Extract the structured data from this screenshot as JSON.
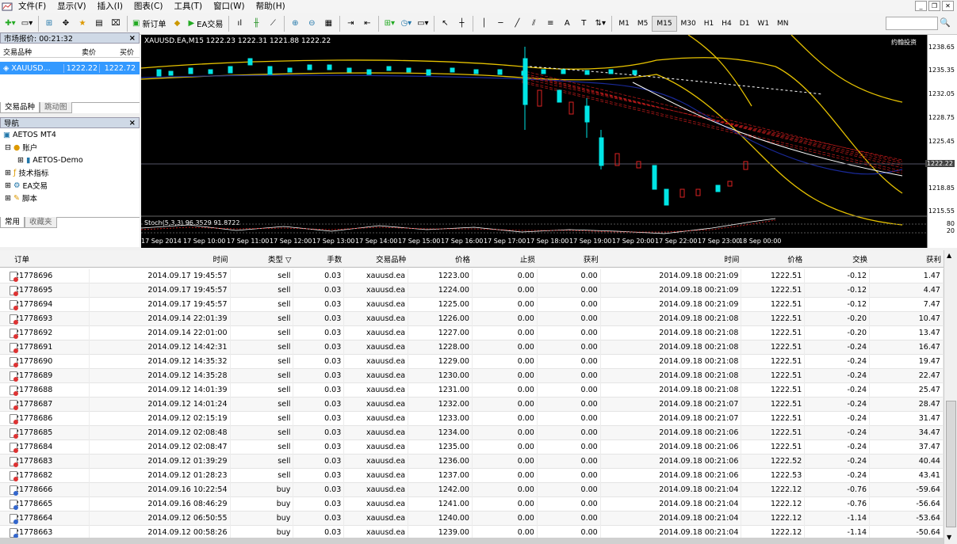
{
  "menu": {
    "items": [
      "文件(F)",
      "显示(V)",
      "插入(I)",
      "图表(C)",
      "工具(T)",
      "窗口(W)",
      "帮助(H)"
    ]
  },
  "toolbar": {
    "new_order": "新订单",
    "ea_trade": "EA交易",
    "timeframes": [
      "M1",
      "M5",
      "M15",
      "M30",
      "H1",
      "H4",
      "D1",
      "W1",
      "MN"
    ],
    "active_tf": "M15"
  },
  "market_watch": {
    "title": "市场报价: 00:21:32",
    "col_symbol": "交易品种",
    "col_bid": "卖价",
    "col_ask": "买价",
    "row": {
      "symbol": "XAUUSD...",
      "bid": "1222.22",
      "ask": "1222.72"
    },
    "tabs": [
      "交易品种",
      "跳动图"
    ]
  },
  "navigator": {
    "title": "导航",
    "items": [
      "AETOS MT4",
      "账户",
      "AETOS-Demo",
      "技术指标",
      "EA交易",
      "脚本"
    ],
    "tabs": [
      "常用",
      "收藏夹"
    ]
  },
  "chart": {
    "header": "XAUUSD.EA,M15  1222.23 1222.31 1221.88 1222.22",
    "corner_label": "约翰投资",
    "stoch_label": "Stoch(5,3,3) 96.3529 91.8722",
    "price_ticks": [
      "1238.65",
      "1235.35",
      "1232.05",
      "1228.75",
      "1225.45",
      "1222.22",
      "1218.85",
      "1215.55"
    ],
    "stoch_ticks": [
      "80",
      "20"
    ],
    "time_ticks": [
      "17 Sep 2014",
      "17 Sep 10:00",
      "17 Sep 11:00",
      "17 Sep 12:00",
      "17 Sep 13:00",
      "17 Sep 14:00",
      "17 Sep 15:00",
      "17 Sep 16:00",
      "17 Sep 17:00",
      "17 Sep 18:00",
      "17 Sep 19:00",
      "17 Sep 20:00",
      "17 Sep 22:00",
      "17 Sep 23:00",
      "18 Sep 00:00"
    ]
  },
  "terminal": {
    "headers": [
      "订单",
      "时间",
      "类型",
      "手数",
      "交易品种",
      "价格",
      "止损",
      "获利",
      "时间",
      "价格",
      "交换",
      "获利"
    ],
    "rows": [
      [
        "21778696",
        "2014.09.17 19:45:57",
        "sell",
        "0.03",
        "xauusd.ea",
        "1223.00",
        "0.00",
        "0.00",
        "2014.09.18 00:21:09",
        "1222.51",
        "-0.12",
        "1.47"
      ],
      [
        "21778695",
        "2014.09.17 19:45:57",
        "sell",
        "0.03",
        "xauusd.ea",
        "1224.00",
        "0.00",
        "0.00",
        "2014.09.18 00:21:09",
        "1222.51",
        "-0.12",
        "4.47"
      ],
      [
        "21778694",
        "2014.09.17 19:45:57",
        "sell",
        "0.03",
        "xauusd.ea",
        "1225.00",
        "0.00",
        "0.00",
        "2014.09.18 00:21:09",
        "1222.51",
        "-0.12",
        "7.47"
      ],
      [
        "21778693",
        "2014.09.14 22:01:39",
        "sell",
        "0.03",
        "xauusd.ea",
        "1226.00",
        "0.00",
        "0.00",
        "2014.09.18 00:21:08",
        "1222.51",
        "-0.20",
        "10.47"
      ],
      [
        "21778692",
        "2014.09.14 22:01:00",
        "sell",
        "0.03",
        "xauusd.ea",
        "1227.00",
        "0.00",
        "0.00",
        "2014.09.18 00:21:08",
        "1222.51",
        "-0.20",
        "13.47"
      ],
      [
        "21778691",
        "2014.09.12 14:42:31",
        "sell",
        "0.03",
        "xauusd.ea",
        "1228.00",
        "0.00",
        "0.00",
        "2014.09.18 00:21:08",
        "1222.51",
        "-0.24",
        "16.47"
      ],
      [
        "21778690",
        "2014.09.12 14:35:32",
        "sell",
        "0.03",
        "xauusd.ea",
        "1229.00",
        "0.00",
        "0.00",
        "2014.09.18 00:21:08",
        "1222.51",
        "-0.24",
        "19.47"
      ],
      [
        "21778689",
        "2014.09.12 14:35:28",
        "sell",
        "0.03",
        "xauusd.ea",
        "1230.00",
        "0.00",
        "0.00",
        "2014.09.18 00:21:08",
        "1222.51",
        "-0.24",
        "22.47"
      ],
      [
        "21778688",
        "2014.09.12 14:01:39",
        "sell",
        "0.03",
        "xauusd.ea",
        "1231.00",
        "0.00",
        "0.00",
        "2014.09.18 00:21:08",
        "1222.51",
        "-0.24",
        "25.47"
      ],
      [
        "21778687",
        "2014.09.12 14:01:24",
        "sell",
        "0.03",
        "xauusd.ea",
        "1232.00",
        "0.00",
        "0.00",
        "2014.09.18 00:21:07",
        "1222.51",
        "-0.24",
        "28.47"
      ],
      [
        "21778686",
        "2014.09.12 02:15:19",
        "sell",
        "0.03",
        "xauusd.ea",
        "1233.00",
        "0.00",
        "0.00",
        "2014.09.18 00:21:07",
        "1222.51",
        "-0.24",
        "31.47"
      ],
      [
        "21778685",
        "2014.09.12 02:08:48",
        "sell",
        "0.03",
        "xauusd.ea",
        "1234.00",
        "0.00",
        "0.00",
        "2014.09.18 00:21:06",
        "1222.51",
        "-0.24",
        "34.47"
      ],
      [
        "21778684",
        "2014.09.12 02:08:47",
        "sell",
        "0.03",
        "xauusd.ea",
        "1235.00",
        "0.00",
        "0.00",
        "2014.09.18 00:21:06",
        "1222.51",
        "-0.24",
        "37.47"
      ],
      [
        "21778683",
        "2014.09.12 01:39:29",
        "sell",
        "0.03",
        "xauusd.ea",
        "1236.00",
        "0.00",
        "0.00",
        "2014.09.18 00:21:06",
        "1222.52",
        "-0.24",
        "40.44"
      ],
      [
        "21778682",
        "2014.09.12 01:28:23",
        "sell",
        "0.03",
        "xauusd.ea",
        "1237.00",
        "0.00",
        "0.00",
        "2014.09.18 00:21:06",
        "1222.53",
        "-0.24",
        "43.41"
      ],
      [
        "21778666",
        "2014.09.16 10:22:54",
        "buy",
        "0.03",
        "xauusd.ea",
        "1242.00",
        "0.00",
        "0.00",
        "2014.09.18 00:21:04",
        "1222.12",
        "-0.76",
        "-59.64"
      ],
      [
        "21778665",
        "2014.09.16 08:46:29",
        "buy",
        "0.03",
        "xauusd.ea",
        "1241.00",
        "0.00",
        "0.00",
        "2014.09.18 00:21:04",
        "1222.12",
        "-0.76",
        "-56.64"
      ],
      [
        "21778664",
        "2014.09.12 06:50:55",
        "buy",
        "0.03",
        "xauusd.ea",
        "1240.00",
        "0.00",
        "0.00",
        "2014.09.18 00:21:04",
        "1222.12",
        "-1.14",
        "-53.64"
      ],
      [
        "21778663",
        "2014.09.12 00:58:26",
        "buy",
        "0.03",
        "xauusd.ea",
        "1239.00",
        "0.00",
        "0.00",
        "2014.09.18 00:21:04",
        "1222.12",
        "-1.14",
        "-50.64"
      ]
    ]
  }
}
